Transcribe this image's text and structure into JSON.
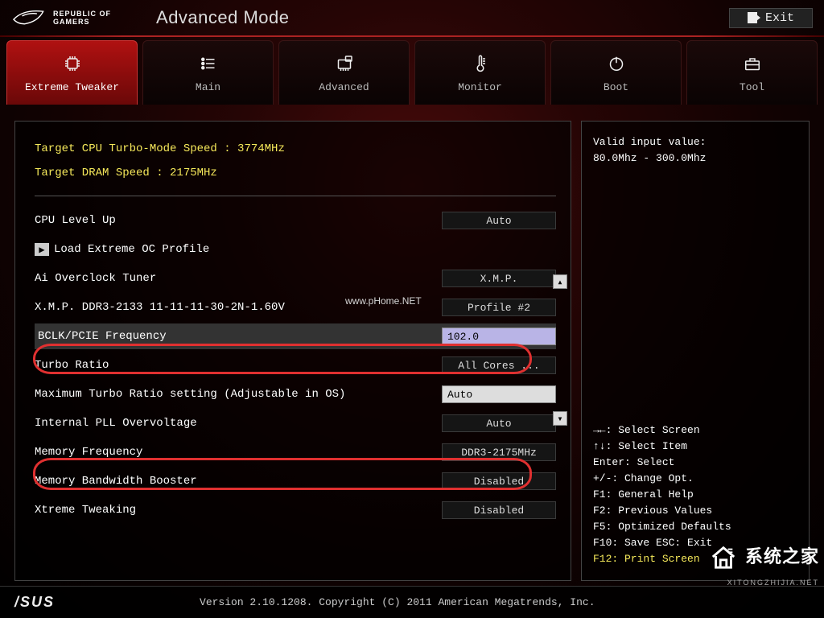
{
  "header": {
    "brand_line1": "REPUBLIC OF",
    "brand_line2": "GAMERS",
    "mode_title": "Advanced Mode",
    "exit_label": "Exit"
  },
  "tabs": [
    {
      "label": "Extreme Tweaker",
      "icon": "chip-icon",
      "active": true
    },
    {
      "label": "Main",
      "icon": "list-icon",
      "active": false
    },
    {
      "label": "Advanced",
      "icon": "chipset-icon",
      "active": false
    },
    {
      "label": "Monitor",
      "icon": "thermometer-icon",
      "active": false
    },
    {
      "label": "Boot",
      "icon": "power-icon",
      "active": false
    },
    {
      "label": "Tool",
      "icon": "toolbox-icon",
      "active": false
    }
  ],
  "targets": {
    "cpu_line": "Target CPU Turbo-Mode Speed : 3774MHz",
    "dram_line": "Target DRAM Speed : 2175MHz"
  },
  "settings": {
    "cpu_level_up": {
      "label": "CPU Level Up",
      "value": "Auto"
    },
    "load_profile": {
      "label": "Load Extreme OC Profile"
    },
    "ai_tuner": {
      "label": "Ai Overclock Tuner",
      "value": "X.M.P."
    },
    "xmp": {
      "label": "X.M.P. DDR3-2133 11-11-11-30-2N-1.60V",
      "value": "Profile #2"
    },
    "bclk": {
      "label": "BCLK/PCIE Frequency",
      "value": "102.0"
    },
    "turbo_ratio": {
      "label": "Turbo Ratio",
      "value": "All Cores ..."
    },
    "max_turbo": {
      "label": "Maximum Turbo Ratio setting (Adjustable in OS)",
      "value": "Auto"
    },
    "pll": {
      "label": "Internal PLL Overvoltage",
      "value": "Auto"
    },
    "mem_freq": {
      "label": "Memory Frequency",
      "value": "DDR3-2175MHz"
    },
    "mem_bw": {
      "label": "Memory Bandwidth Booster",
      "value": "Disabled"
    },
    "xtreme": {
      "label": "Xtreme Tweaking",
      "value": "Disabled"
    }
  },
  "help": {
    "valid_title": "Valid input value:",
    "valid_range": "80.0Mhz - 300.0Mhz",
    "cmds": [
      "→←: Select Screen",
      "↑↓: Select Item",
      "Enter: Select",
      "+/-: Change Opt.",
      "F1: General Help",
      "F2: Previous Values",
      "F5: Optimized Defaults",
      "F10: Save  ESC: Exit"
    ],
    "cmd_print": "F12: Print Screen"
  },
  "footer": {
    "vendor": "/SUS",
    "copyright": "Version 2.10.1208. Copyright (C) 2011 American Megatrends, Inc."
  },
  "watermark": {
    "text_cn": "系统之家",
    "text_en": "XITONGZHIJIA.NET",
    "url_overlay": "www.pHome.NET"
  }
}
